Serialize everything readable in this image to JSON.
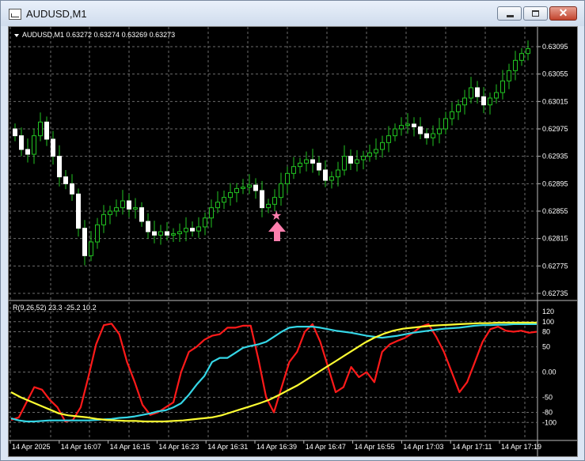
{
  "window": {
    "title": "AUDUSD,M1",
    "buttons": {
      "minimize": "minimize",
      "maximize": "maximize",
      "close": "✕"
    }
  },
  "colors": {
    "background": "#000000",
    "grid": "#6b6b6b",
    "candle": "#22c522",
    "text": "#ffffff",
    "signal_marker": "#ff7fae",
    "red_line": "#ff1a1a",
    "cyan_line": "#35d6e6",
    "yellow_line": "#ffff33"
  },
  "main_chart": {
    "header": "AUDUSD,M1  0.63272 0.63274 0.63269 0.63273",
    "price_labels": [
      "0.63095",
      "0.63055",
      "0.63015",
      "0.62975",
      "0.62935",
      "0.62895",
      "0.62855",
      "0.62815",
      "0.62775",
      "0.62735"
    ],
    "signal_markers": [
      {
        "type": "star",
        "icon": "star-icon"
      },
      {
        "type": "up-arrow",
        "icon": "arrow-up-icon"
      }
    ]
  },
  "indicator": {
    "header": "R(9,26,52) 23.3 -25.2 10.2",
    "scale_labels": [
      "120",
      "100",
      "80",
      "50",
      "0.00",
      "-50",
      "-80",
      "-100"
    ]
  },
  "time_labels": [
    "14 Apr 2025",
    "14 Apr 16:07",
    "14 Apr 16:15",
    "14 Apr 16:23",
    "14 Apr 16:31",
    "14 Apr 16:39",
    "14 Apr 16:47",
    "14 Apr 16:55",
    "14 Apr 17:03",
    "14 Apr 17:11",
    "14 Apr 17:19"
  ],
  "chart_data": [
    {
      "type": "candlestick",
      "title": "AUDUSD,M1",
      "y_range": [
        0.6273,
        0.6312
      ],
      "close_series": [
        0.62965,
        0.62945,
        0.62938,
        0.62965,
        0.62985,
        0.6296,
        0.62935,
        0.62905,
        0.62895,
        0.6288,
        0.6283,
        0.6279,
        0.6281,
        0.62835,
        0.6285,
        0.62855,
        0.6286,
        0.6287,
        0.62858,
        0.6286,
        0.6284,
        0.62825,
        0.6282,
        0.62825,
        0.6282,
        0.62822,
        0.62825,
        0.6283,
        0.62826,
        0.62832,
        0.62845,
        0.6286,
        0.62868,
        0.62875,
        0.62882,
        0.62888,
        0.6289,
        0.62893,
        0.62885,
        0.6286,
        0.62865,
        0.62875,
        0.62895,
        0.6291,
        0.6292,
        0.62925,
        0.6293,
        0.62925,
        0.62915,
        0.629,
        0.62905,
        0.62915,
        0.62935,
        0.62925,
        0.6293,
        0.62935,
        0.6294,
        0.62945,
        0.62955,
        0.62965,
        0.62975,
        0.6298,
        0.62982,
        0.62978,
        0.62968,
        0.62962,
        0.62968,
        0.62975,
        0.6299,
        0.63,
        0.6301,
        0.6302,
        0.63035,
        0.63022,
        0.6301,
        0.6302,
        0.63028,
        0.63045,
        0.6306,
        0.63075,
        0.63085,
        0.63092
      ]
    },
    {
      "type": "line",
      "title": "R(9,26,52) 23.3 -25.2 10.2",
      "y_range": [
        -120,
        120
      ],
      "x_count": 80,
      "series": [
        {
          "name": "R(9)",
          "color": "#ff1a1a",
          "values": [
            -95,
            -90,
            -60,
            -30,
            -35,
            -55,
            -70,
            -98,
            -95,
            -70,
            -10,
            55,
            93,
            96,
            75,
            20,
            -20,
            -65,
            -85,
            -80,
            -70,
            -60,
            0,
            40,
            50,
            64,
            72,
            75,
            88,
            88,
            92,
            92,
            25,
            -50,
            -80,
            -30,
            20,
            40,
            80,
            95,
            60,
            10,
            -40,
            -30,
            10,
            -10,
            0,
            -20,
            40,
            55,
            62,
            68,
            78,
            90,
            95,
            70,
            40,
            0,
            -40,
            -20,
            20,
            60,
            85,
            90,
            82,
            80,
            82,
            78,
            80
          ],
          "x0": 0
        },
        {
          "name": "R(26)",
          "color": "#35d6e6",
          "values": [
            -92,
            -96,
            -98,
            -98,
            -97,
            -96,
            -96,
            -96,
            -96,
            -96,
            -96,
            -95,
            -94,
            -93,
            -91,
            -90,
            -88,
            -85,
            -82,
            -78,
            -76,
            -70,
            -62,
            -45,
            -25,
            -8,
            20,
            28,
            28,
            38,
            48,
            52,
            55,
            60,
            70,
            80,
            88,
            90,
            90,
            90,
            88,
            85,
            82,
            80,
            78,
            75,
            72,
            70,
            68,
            70,
            72,
            75,
            78,
            80,
            82,
            84,
            86,
            87,
            88,
            90,
            92,
            93,
            93,
            94,
            94,
            95,
            95,
            95,
            95
          ],
          "x0": 0
        },
        {
          "name": "R(52)",
          "color": "#ffff33",
          "values": [
            -40,
            -50,
            -58,
            -66,
            -74,
            -82,
            -86,
            -88,
            -90,
            -93,
            -95,
            -96,
            -97,
            -97,
            -98,
            -98,
            -98,
            -97,
            -96,
            -94,
            -92,
            -90,
            -86,
            -80,
            -74,
            -68,
            -62,
            -55,
            -46,
            -36,
            -26,
            -14,
            -2,
            10,
            22,
            34,
            46,
            58,
            68,
            76,
            82,
            86,
            88,
            90,
            92,
            93,
            94,
            95,
            96,
            97,
            97,
            98,
            98,
            98,
            98,
            98
          ],
          "x0": 0
        }
      ]
    }
  ]
}
